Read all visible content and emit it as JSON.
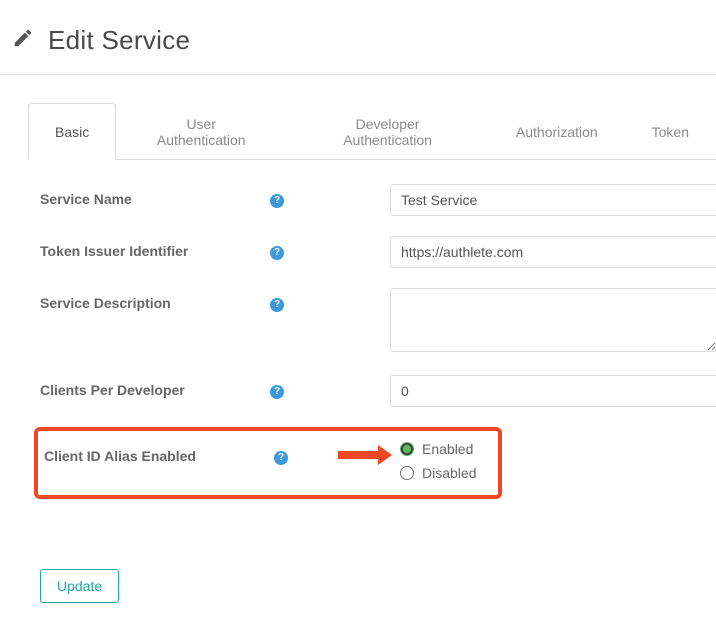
{
  "header": {
    "title": "Edit Service"
  },
  "tabs": [
    {
      "label": "Basic",
      "active": true
    },
    {
      "label": "User Authentication",
      "active": false
    },
    {
      "label": "Developer Authentication",
      "active": false
    },
    {
      "label": "Authorization",
      "active": false
    },
    {
      "label": "Token",
      "active": false
    }
  ],
  "form": {
    "serviceName": {
      "label": "Service Name",
      "value": "Test Service"
    },
    "tokenIssuer": {
      "label": "Token Issuer Identifier",
      "value": "https://authlete.com"
    },
    "serviceDesc": {
      "label": "Service Description",
      "value": ""
    },
    "clientsPerDev": {
      "label": "Clients Per Developer",
      "value": "0"
    },
    "clientIdAlias": {
      "label": "Client ID Alias Enabled",
      "options": {
        "enabled": "Enabled",
        "disabled": "Disabled"
      },
      "selected": "enabled"
    }
  },
  "buttons": {
    "update": "Update"
  }
}
